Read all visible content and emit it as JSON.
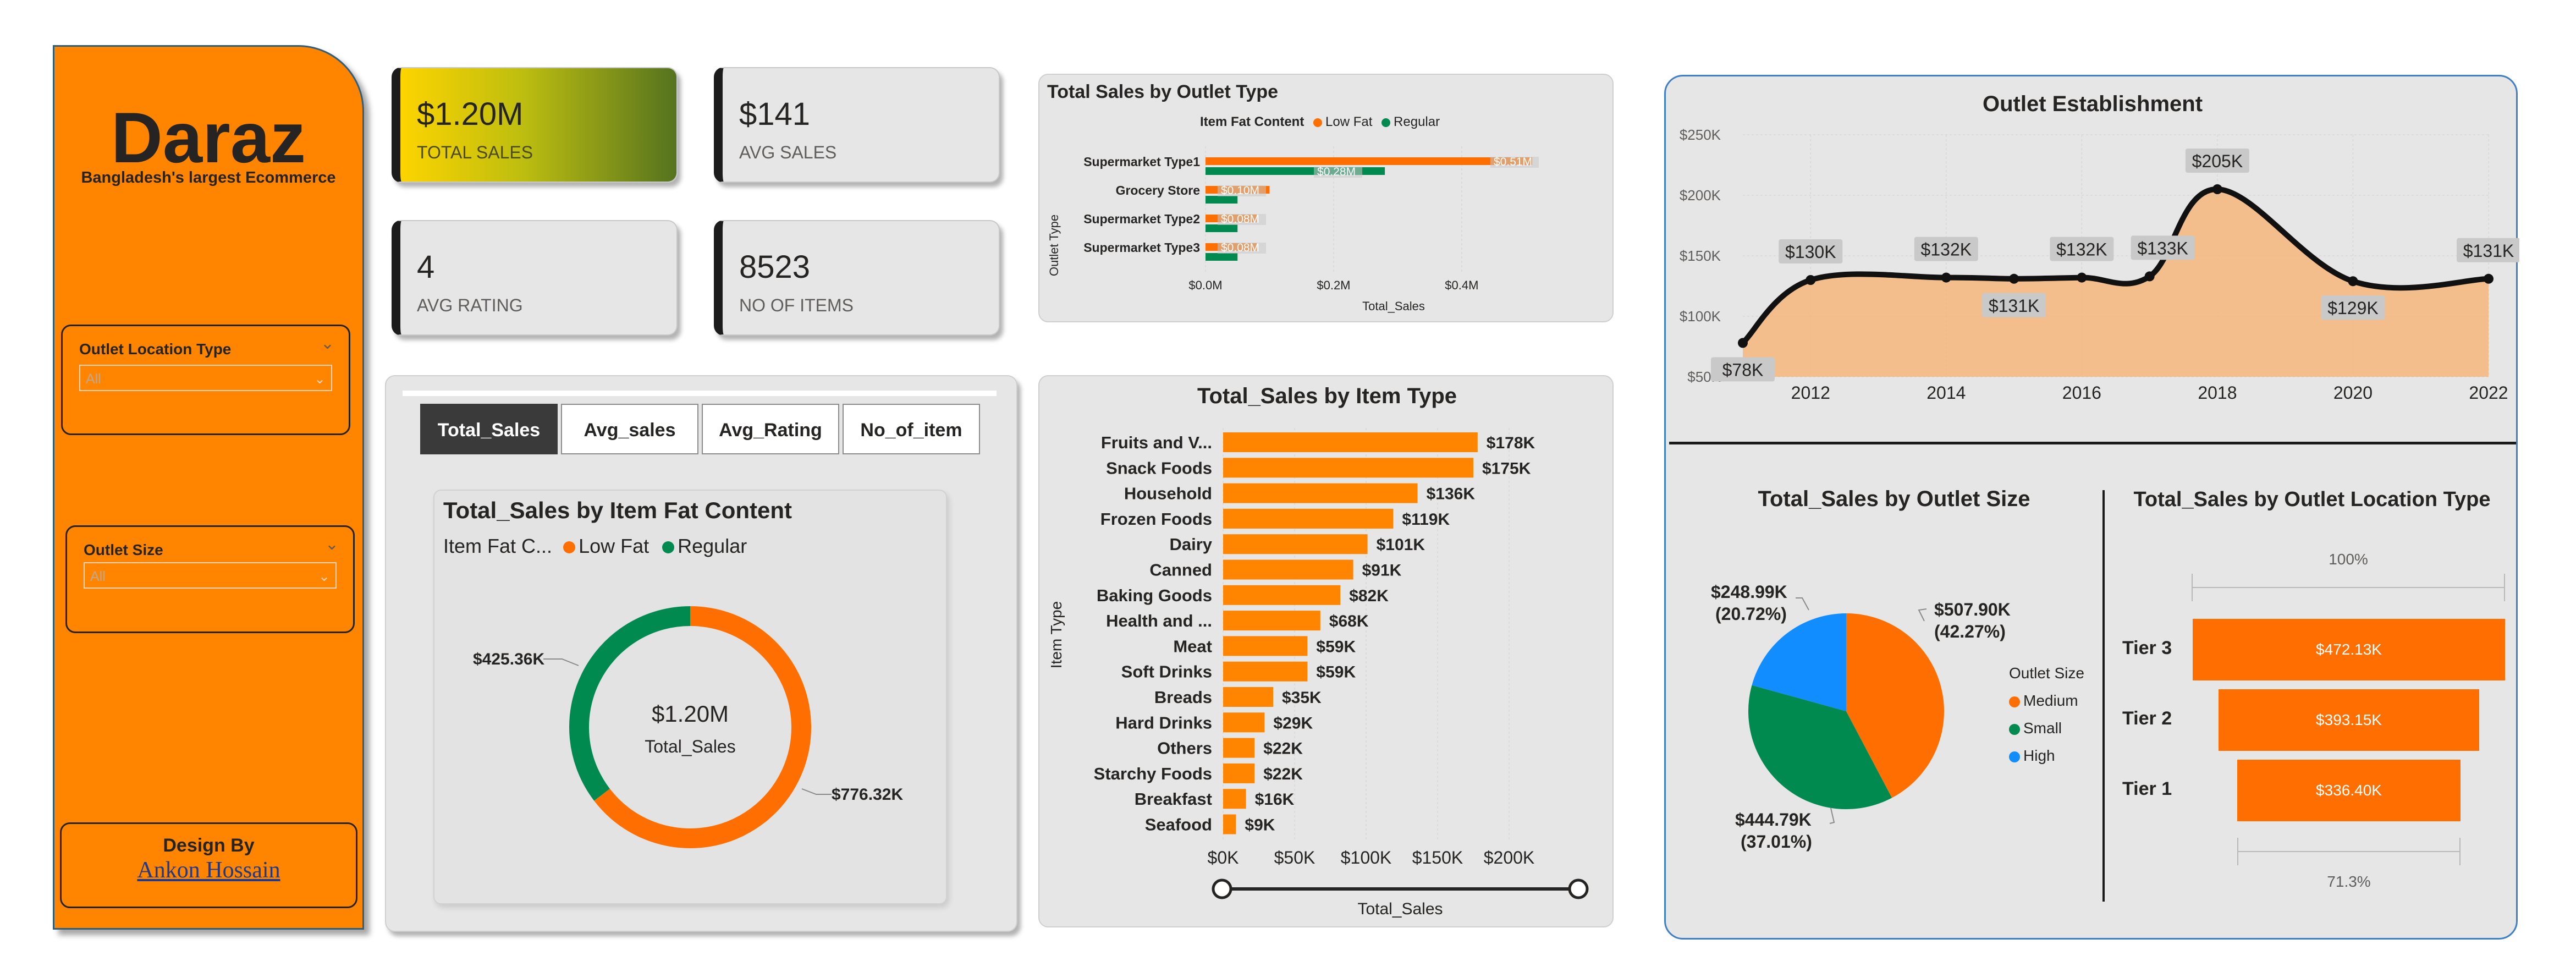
{
  "brand": {
    "name": "Daraz",
    "tagline": "Bangladesh's largest Ecommerce"
  },
  "slicers": [
    {
      "title": "Outlet Location Type",
      "value": "All"
    },
    {
      "title": "Outlet Size",
      "value": "All"
    }
  ],
  "design": {
    "label": "Design By",
    "author": "Ankon Hossain"
  },
  "kpis": [
    {
      "value": "$1.20M",
      "label": "TOTAL SALES"
    },
    {
      "value": "$141",
      "label": "AVG SALES"
    },
    {
      "value": "4",
      "label": "AVG RATING"
    },
    {
      "value": "8523",
      "label": "NO OF ITEMS"
    }
  ],
  "tabs": [
    "Total_Sales",
    "Avg_sales",
    "Avg_Rating",
    "No_of_item"
  ],
  "colors": {
    "low_fat": "#ff6e00",
    "regular": "#008a4f",
    "orange_bar": "#ff8400",
    "medium": "#ff6e00",
    "small": "#008a4f",
    "high": "#118dff",
    "line": "#111111",
    "area": "#f4b67a"
  },
  "fat_content": {
    "title": "Total_Sales by Item Fat Content",
    "legend_title": "Item Fat C...",
    "legend": [
      "Low Fat",
      "Regular"
    ],
    "center_value": "$1.20M",
    "center_label": "Total_Sales",
    "label_regular": "$425.36K",
    "label_low_fat": "$776.32K"
  },
  "outlet_type": {
    "title": "Total Sales by Outlet Type",
    "legend_title": "Item Fat Content",
    "legend": [
      "Low Fat",
      "Regular"
    ],
    "y_axis_label": "Outlet Type",
    "x_axis_label": "Total_Sales",
    "x_ticks": [
      "$0.0M",
      "$0.2M",
      "$0.4M"
    ],
    "categories": [
      "Supermarket Type1",
      "Grocery Store",
      "Supermarket Type2",
      "Supermarket Type3"
    ],
    "labels_low": [
      "$0.51M",
      "$0.10M",
      "$0.08M",
      "$0.08M"
    ],
    "labels_reg": [
      "$0.28M",
      "",
      "",
      ""
    ]
  },
  "item_type": {
    "title": "Total_Sales by Item Type",
    "y_axis_label": "Item Type",
    "x_axis_label": "Total_Sales",
    "x_ticks": [
      "$0K",
      "$50K",
      "$100K",
      "$150K",
      "$200K"
    ],
    "value_labels": [
      "$178K",
      "$175K",
      "$136K",
      "$119K",
      "$101K",
      "$91K",
      "$82K",
      "$68K",
      "$59K",
      "$59K",
      "$35K",
      "$29K",
      "$22K",
      "$22K",
      "$16K",
      "$9K"
    ]
  },
  "establishment": {
    "title": "Outlet Establishment",
    "y_ticks": [
      "$250K",
      "$200K",
      "$150K",
      "$100K",
      "$50K"
    ],
    "x_ticks": [
      "2012",
      "2014",
      "2016",
      "2018",
      "2020",
      "2022"
    ],
    "point_labels": [
      "$78K",
      "$130K",
      "$132K",
      "$131K",
      "$132K",
      "$133K",
      "$205K",
      "$129K",
      "$131K"
    ]
  },
  "outlet_size": {
    "title": "Total_Sales by Outlet Size",
    "legend_title": "Outlet Size",
    "legend": [
      "Medium",
      "Small",
      "High"
    ],
    "label_medium": [
      "$507.90K",
      "(42.27%)"
    ],
    "label_small": [
      "$444.79K",
      "(37.01%)"
    ],
    "label_high": [
      "$248.99K",
      "(20.72%)"
    ]
  },
  "location_type": {
    "title": "Total_Sales by Outlet Location Type",
    "top_pct": "100%",
    "bottom_pct": "71.3%",
    "tiers": [
      "Tier 3",
      "Tier 2",
      "Tier 1"
    ],
    "tier_labels": [
      "$472.13K",
      "$393.15K",
      "$336.40K"
    ]
  },
  "chart_data": [
    {
      "type": "pie",
      "title": "Total_Sales by Item Fat Content",
      "categories": [
        "Low Fat",
        "Regular"
      ],
      "values": [
        776.32,
        425.36
      ],
      "unit": "$K",
      "center": "$1.20M"
    },
    {
      "type": "bar",
      "title": "Total Sales by Outlet Type",
      "categories": [
        "Supermarket Type1",
        "Grocery Store",
        "Supermarket Type2",
        "Supermarket Type3"
      ],
      "series": [
        {
          "name": "Low Fat",
          "values": [
            0.51,
            0.1,
            0.08,
            0.08
          ]
        },
        {
          "name": "Regular",
          "values": [
            0.28,
            0.05,
            0.05,
            0.05
          ]
        }
      ],
      "xlabel": "Total_Sales",
      "ylabel": "Outlet Type",
      "xlim": [
        0,
        0.51
      ],
      "unit": "$M"
    },
    {
      "type": "bar",
      "title": "Total_Sales by Item Type",
      "categories": [
        "Fruits and V...",
        "Snack Foods",
        "Household",
        "Frozen Foods",
        "Dairy",
        "Canned",
        "Baking Goods",
        "Health and ...",
        "Meat",
        "Soft Drinks",
        "Breads",
        "Hard Drinks",
        "Others",
        "Starchy Foods",
        "Breakfast",
        "Seafood"
      ],
      "values": [
        178,
        175,
        136,
        119,
        101,
        91,
        82,
        68,
        59,
        59,
        35,
        29,
        22,
        22,
        16,
        9
      ],
      "xlabel": "Total_Sales",
      "ylabel": "Item Type",
      "xlim": [
        0,
        200
      ],
      "unit": "$K"
    },
    {
      "type": "area",
      "title": "Outlet Establishment",
      "x": [
        2011,
        2012,
        2014,
        2015,
        2016,
        2017,
        2018,
        2020,
        2022
      ],
      "values": [
        78,
        130,
        132,
        131,
        132,
        133,
        205,
        129,
        131
      ],
      "ylim": [
        50,
        250
      ],
      "xlim": [
        2011,
        2022
      ],
      "unit": "$K"
    },
    {
      "type": "pie",
      "title": "Total_Sales by Outlet Size",
      "categories": [
        "Medium",
        "Small",
        "High"
      ],
      "values": [
        507.9,
        444.79,
        248.99
      ],
      "percents": [
        42.27,
        37.01,
        20.72
      ],
      "unit": "$K"
    },
    {
      "type": "bar",
      "title": "Total_Sales by Outlet Location Type",
      "categories": [
        "Tier 3",
        "Tier 2",
        "Tier 1"
      ],
      "values": [
        472.13,
        393.15,
        336.4
      ],
      "unit": "$K"
    }
  ]
}
